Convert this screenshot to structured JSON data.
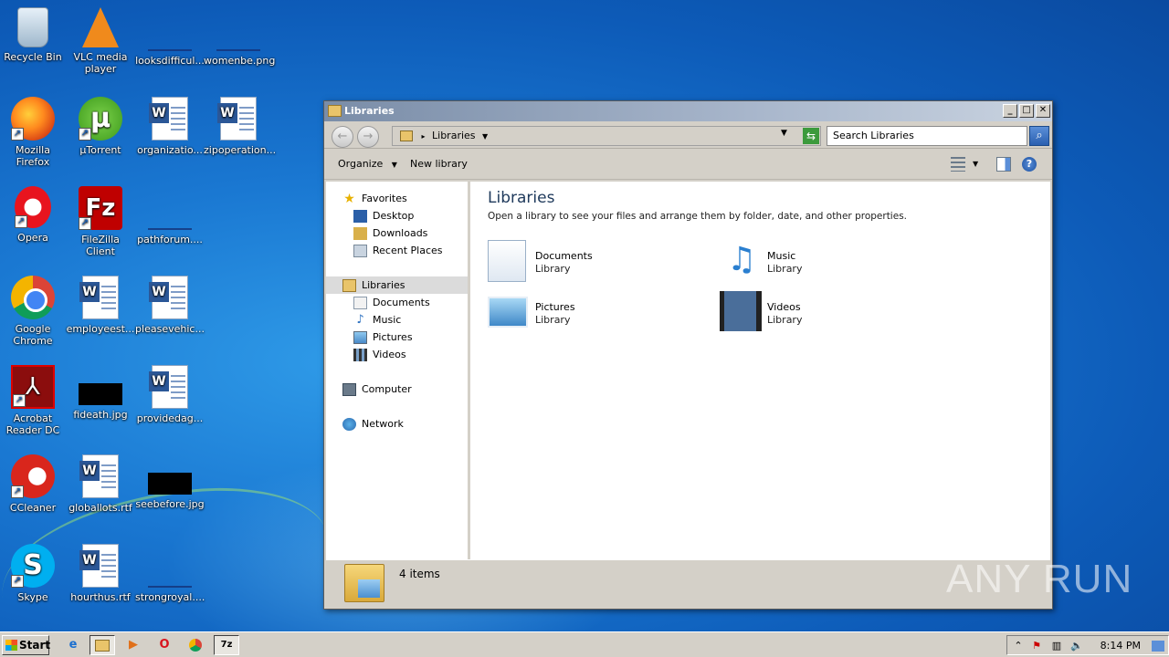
{
  "desktop": {
    "icons": [
      {
        "label": "Recycle Bin",
        "icon": "recycle-bin-icon"
      },
      {
        "label": "VLC media player",
        "icon": "vlc-icon"
      },
      {
        "label": "looksdifficul...",
        "icon": "image-file-icon"
      },
      {
        "label": "womenbe.png",
        "icon": "image-file-icon"
      },
      {
        "label": "Mozilla Firefox",
        "icon": "firefox-icon"
      },
      {
        "label": "µTorrent",
        "icon": "utorrent-icon"
      },
      {
        "label": "organizatio...",
        "icon": "word-document-icon"
      },
      {
        "label": "zipoperation...",
        "icon": "word-document-icon"
      },
      {
        "label": "Opera",
        "icon": "opera-icon"
      },
      {
        "label": "FileZilla Client",
        "icon": "filezilla-icon"
      },
      {
        "label": "pathforum....",
        "icon": "image-file-icon"
      },
      {
        "label": "Google Chrome",
        "icon": "chrome-icon"
      },
      {
        "label": "employeest...",
        "icon": "word-document-icon"
      },
      {
        "label": "pleasevehic...",
        "icon": "word-document-icon"
      },
      {
        "label": "Acrobat Reader DC",
        "icon": "acrobat-icon"
      },
      {
        "label": "fideath.jpg",
        "icon": "image-file-icon"
      },
      {
        "label": "providedag...",
        "icon": "word-document-icon"
      },
      {
        "label": "CCleaner",
        "icon": "ccleaner-icon"
      },
      {
        "label": "globallots.rtf",
        "icon": "word-document-icon"
      },
      {
        "label": "seebefore.jpg",
        "icon": "image-file-icon"
      },
      {
        "label": "Skype",
        "icon": "skype-icon"
      },
      {
        "label": "hourthus.rtf",
        "icon": "word-document-icon"
      },
      {
        "label": "strongroyal....",
        "icon": "image-file-icon"
      }
    ]
  },
  "window": {
    "title": "Libraries",
    "address": {
      "crumb": "Libraries",
      "separator": "▸"
    },
    "search": {
      "placeholder": "Search Libraries"
    },
    "toolbar": {
      "organize": "Organize",
      "new_library": "New library"
    },
    "nav": {
      "favorites": "Favorites",
      "desktop": "Desktop",
      "downloads": "Downloads",
      "recent_places": "Recent Places",
      "libraries": "Libraries",
      "documents": "Documents",
      "music": "Music",
      "pictures": "Pictures",
      "videos": "Videos",
      "computer": "Computer",
      "network": "Network"
    },
    "main": {
      "heading": "Libraries",
      "subheading": "Open a library to see your files and arrange them by folder, date, and other properties.",
      "libraries": [
        {
          "name": "Documents",
          "type": "Library"
        },
        {
          "name": "Music",
          "type": "Library"
        },
        {
          "name": "Pictures",
          "type": "Library"
        },
        {
          "name": "Videos",
          "type": "Library"
        }
      ]
    },
    "status": {
      "count": "4 items"
    }
  },
  "taskbar": {
    "start": "Start",
    "clock": "8:14 PM"
  },
  "watermark": "ANY RUN"
}
